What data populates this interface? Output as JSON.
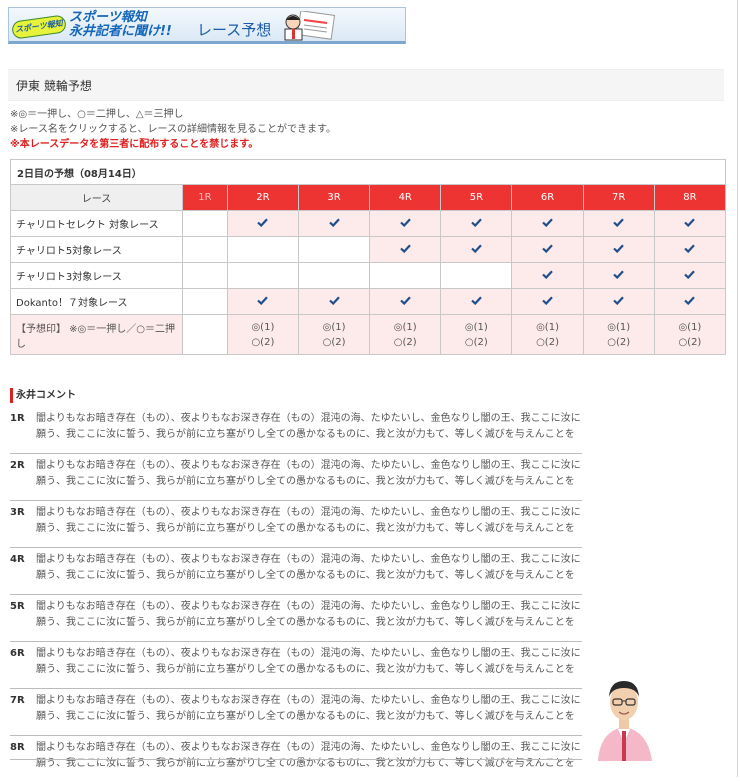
{
  "banner": {
    "logo_text": "スポーツ報知",
    "line1": "スポーツ報知",
    "line2": "永井記者に聞け!!",
    "race_title": "レース予想"
  },
  "page_title": "伊東 競輪予想",
  "notes": {
    "line1": "※◎＝一押し、○＝二押し、△＝三押し",
    "line2": "※レース名をクリックすると、レースの詳細情報を見ることができます。",
    "warning": "※本レースデータを第三者に配布することを禁じます。"
  },
  "table": {
    "caption": "2日目の予想（08月14日）",
    "race_header": "レース",
    "races": [
      "1R",
      "2R",
      "3R",
      "4R",
      "5R",
      "6R",
      "7R",
      "8R"
    ],
    "rows": [
      {
        "label": "チャリロトセレクト 対象レース",
        "checks": [
          false,
          true,
          true,
          true,
          true,
          true,
          true,
          true
        ]
      },
      {
        "label": "チャリロト5対象レース",
        "checks": [
          false,
          false,
          false,
          true,
          true,
          true,
          true,
          true
        ]
      },
      {
        "label": "チャリロト3対象レース",
        "checks": [
          false,
          false,
          false,
          false,
          false,
          true,
          true,
          true
        ]
      },
      {
        "label": "Dokanto！７対象レース",
        "checks": [
          false,
          true,
          true,
          true,
          true,
          true,
          true,
          true
        ]
      }
    ],
    "mark_label": "【予想印】 ※◎＝一押し／○＝二押し",
    "mark_first": "◎(1)",
    "mark_second": "○(2)"
  },
  "comment_title": "永井コメント",
  "comments": [
    {
      "race": "1R",
      "text": "闇よりもなお暗き存在（もの）、夜よりもなお深き存在（もの）混沌の海、たゆたいし、金色なりし闇の王、我ここに汝に願う、我ここに汝に誓う、我らが前に立ち塞がりし全ての愚かなるものに、我と汝が力もて、等しく滅びを与えんことを"
    },
    {
      "race": "2R",
      "text": "闇よりもなお暗き存在（もの）、夜よりもなお深き存在（もの）混沌の海、たゆたいし、金色なりし闇の王、我ここに汝に願う、我ここに汝に誓う、我らが前に立ち塞がりし全ての愚かなるものに、我と汝が力もて、等しく滅びを与えんことを"
    },
    {
      "race": "3R",
      "text": "闇よりもなお暗き存在（もの）、夜よりもなお深き存在（もの）混沌の海、たゆたいし、金色なりし闇の王、我ここに汝に願う、我ここに汝に誓う、我らが前に立ち塞がりし全ての愚かなるものに、我と汝が力もて、等しく滅びを与えんことを"
    },
    {
      "race": "4R",
      "text": "闇よりもなお暗き存在（もの）、夜よりもなお深き存在（もの）混沌の海、たゆたいし、金色なりし闇の王、我ここに汝に願う、我ここに汝に誓う、我らが前に立ち塞がりし全ての愚かなるものに、我と汝が力もて、等しく滅びを与えんことを"
    },
    {
      "race": "5R",
      "text": "闇よりもなお暗き存在（もの）、夜よりもなお深き存在（もの）混沌の海、たゆたいし、金色なりし闇の王、我ここに汝に願う、我ここに汝に誓う、我らが前に立ち塞がりし全ての愚かなるものに、我と汝が力もて、等しく滅びを与えんことを"
    },
    {
      "race": "6R",
      "text": "闇よりもなお暗き存在（もの）、夜よりもなお深き存在（もの）混沌の海、たゆたいし、金色なりし闇の王、我ここに汝に願う、我ここに汝に誓う、我らが前に立ち塞がりし全ての愚かなるものに、我と汝が力もて、等しく滅びを与えんことを"
    },
    {
      "race": "7R",
      "text": "闇よりもなお暗き存在（もの）、夜よりもなお深き存在（もの）混沌の海、たゆたいし、金色なりし闇の王、我ここに汝に願う、我ここに汝に誓う、我らが前に立ち塞がりし全ての愚かなるものに、我と汝が力もて、等しく滅びを与えんことを"
    },
    {
      "race": "8R",
      "text": "闇よりもなお暗き存在（もの）、夜よりもなお深き存在（もの）混沌の海、たゆたいし、金色なりし闇の王、我ここに汝に願う、我ここに汝に誓う、我らが前に立ち塞がりし全ての愚かなるものに、我と汝が力もて、等しく滅びを与えんことを"
    }
  ],
  "colors": {
    "accent_red": "#ee3333",
    "row_pink": "#fdeaea",
    "check_blue": "#1f4e8a",
    "banner_blue": "#1466b8"
  },
  "icons": {
    "check": "checkmark-icon",
    "reporter": "reporter-photo",
    "banner_person": "reporter-illustration-icon"
  }
}
